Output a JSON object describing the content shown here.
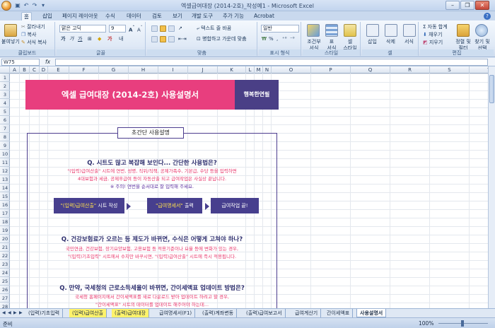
{
  "window": {
    "title": "엑셀급여대장 (2014-2호)_작성예1 - Microsoft Excel"
  },
  "tabs": [
    "홈",
    "삽입",
    "페이지 레이아웃",
    "수식",
    "데이터",
    "검토",
    "보기",
    "개발 도구",
    "추가 기능",
    "Acrobat"
  ],
  "ribbon": {
    "clipboard": {
      "paste": "붙여넣기",
      "cut": "잘라내기",
      "copy": "복사",
      "format_painter": "서식 복사",
      "label": "클립보드"
    },
    "font": {
      "name": "맑은 고딕",
      "size": "9",
      "label": "글꼴"
    },
    "alignment": {
      "wrap": "텍스트 줄 바꿈",
      "merge": "병합하고 가운데 맞춤",
      "label": "맞춤"
    },
    "number": {
      "format": "일반",
      "label": "표시 형식"
    },
    "styles": {
      "conditional": "조건부\n서식",
      "table": "표\n서식",
      "cell": "셀\n스타일",
      "label": "스타일"
    },
    "cells": {
      "insert": "삽입",
      "delete": "삭제",
      "format": "서식",
      "label": "셀"
    },
    "editing": {
      "autosum": "자동 합계",
      "fill": "채우기",
      "clear": "지우기",
      "sort": "정렬 및\n필터",
      "find": "찾기 및\n선택",
      "label": "편집"
    }
  },
  "formula_bar": {
    "cell_ref": "W75",
    "fx": "fx",
    "value": ""
  },
  "columns": [
    "A",
    "B",
    "C",
    "D",
    "E",
    "F",
    "G",
    "H",
    "I",
    "J",
    "K",
    "L",
    "M",
    "N",
    "O",
    "P",
    "Q",
    "R",
    "S",
    "T"
  ],
  "rows": [
    "1",
    "2",
    "3",
    "4",
    "5",
    "6",
    "7",
    "8",
    "9",
    "10",
    "11",
    "12",
    "13",
    "14",
    "15",
    "16",
    "17",
    "18",
    "19",
    "20",
    "21",
    "22",
    "23",
    "24",
    "25",
    "26",
    "27",
    "28"
  ],
  "sheet": {
    "title": "엑셀 급여대장 (2014-2호) 사용설명서",
    "company": "행복한연필",
    "guide_title": "초간단 사용설명",
    "q1": "Q. 시트도 많고 복잡해 보인다... 간단한 사용법은?",
    "q1_l1": "\"(입력)급여산출\" 시트에 연번, 성명, 직위/직책, 공제가족수, 기본급, 수당 등을 입력하면",
    "q1_l2": "4대보험과 세금, 공제후급여 등이 자동산출 되고 급여작업은 사실상 끝납니다.",
    "q1_l3": "※ 주의! 연번을 순서대로 잘 입력해 주세요.",
    "step1": "\"(입력)급여산출\" 시트 작성",
    "step1_hl": "\"(입력)급여산출\"",
    "step1_rest": " 시트 작성",
    "step2_hl": "\"급여명세서\"",
    "step2_rest": " 출력",
    "step3": "급여작업 끝!",
    "q2": "Q. 건강보험료가 오르는 등 제도가 바뀌면, 수식은 어떻게 고쳐야 하나?",
    "q2_l1": "국민연금, 건강보험, 장기요양보험, 고용보험 등 적용기준이나 요율 등에 변화가 있는 경우,",
    "q2_l2": "\"(입력)기초입력\" 시트에서 수치만 바꾸시면, \"(입력)급여산출\" 시트에 즉시 적용됩니다.",
    "q3": "Q. 만약, 국세청의 근로소득세율이 바뀌면, 간이세액표 업데이트 방법은?",
    "q3_l1": "국세청 홈페이지에서 간이세액표를 새로 다운로드 받아 업데이트 하려고 할 경우,",
    "q3_l2": "\"간이세액표\" 시트의 데이터를 업데이트 해주어야 하는데..."
  },
  "sheet_tabs": [
    "(입력)기초입력",
    "(입력)급여산출",
    "(출력)급여대장",
    "급여명세서(F1)",
    "(출력)계좌변동",
    "(출력)급여보고서",
    "급여계산기",
    "간이세액표",
    "사용설명서"
  ],
  "status": {
    "ready": "준비",
    "zoom": "100%"
  },
  "colors": {
    "title_band": "#e83e7e",
    "company_band": "#4a3f86",
    "step_box": "#473f8e",
    "question": "#2e2f6e",
    "pink_text": "#e8366b"
  }
}
